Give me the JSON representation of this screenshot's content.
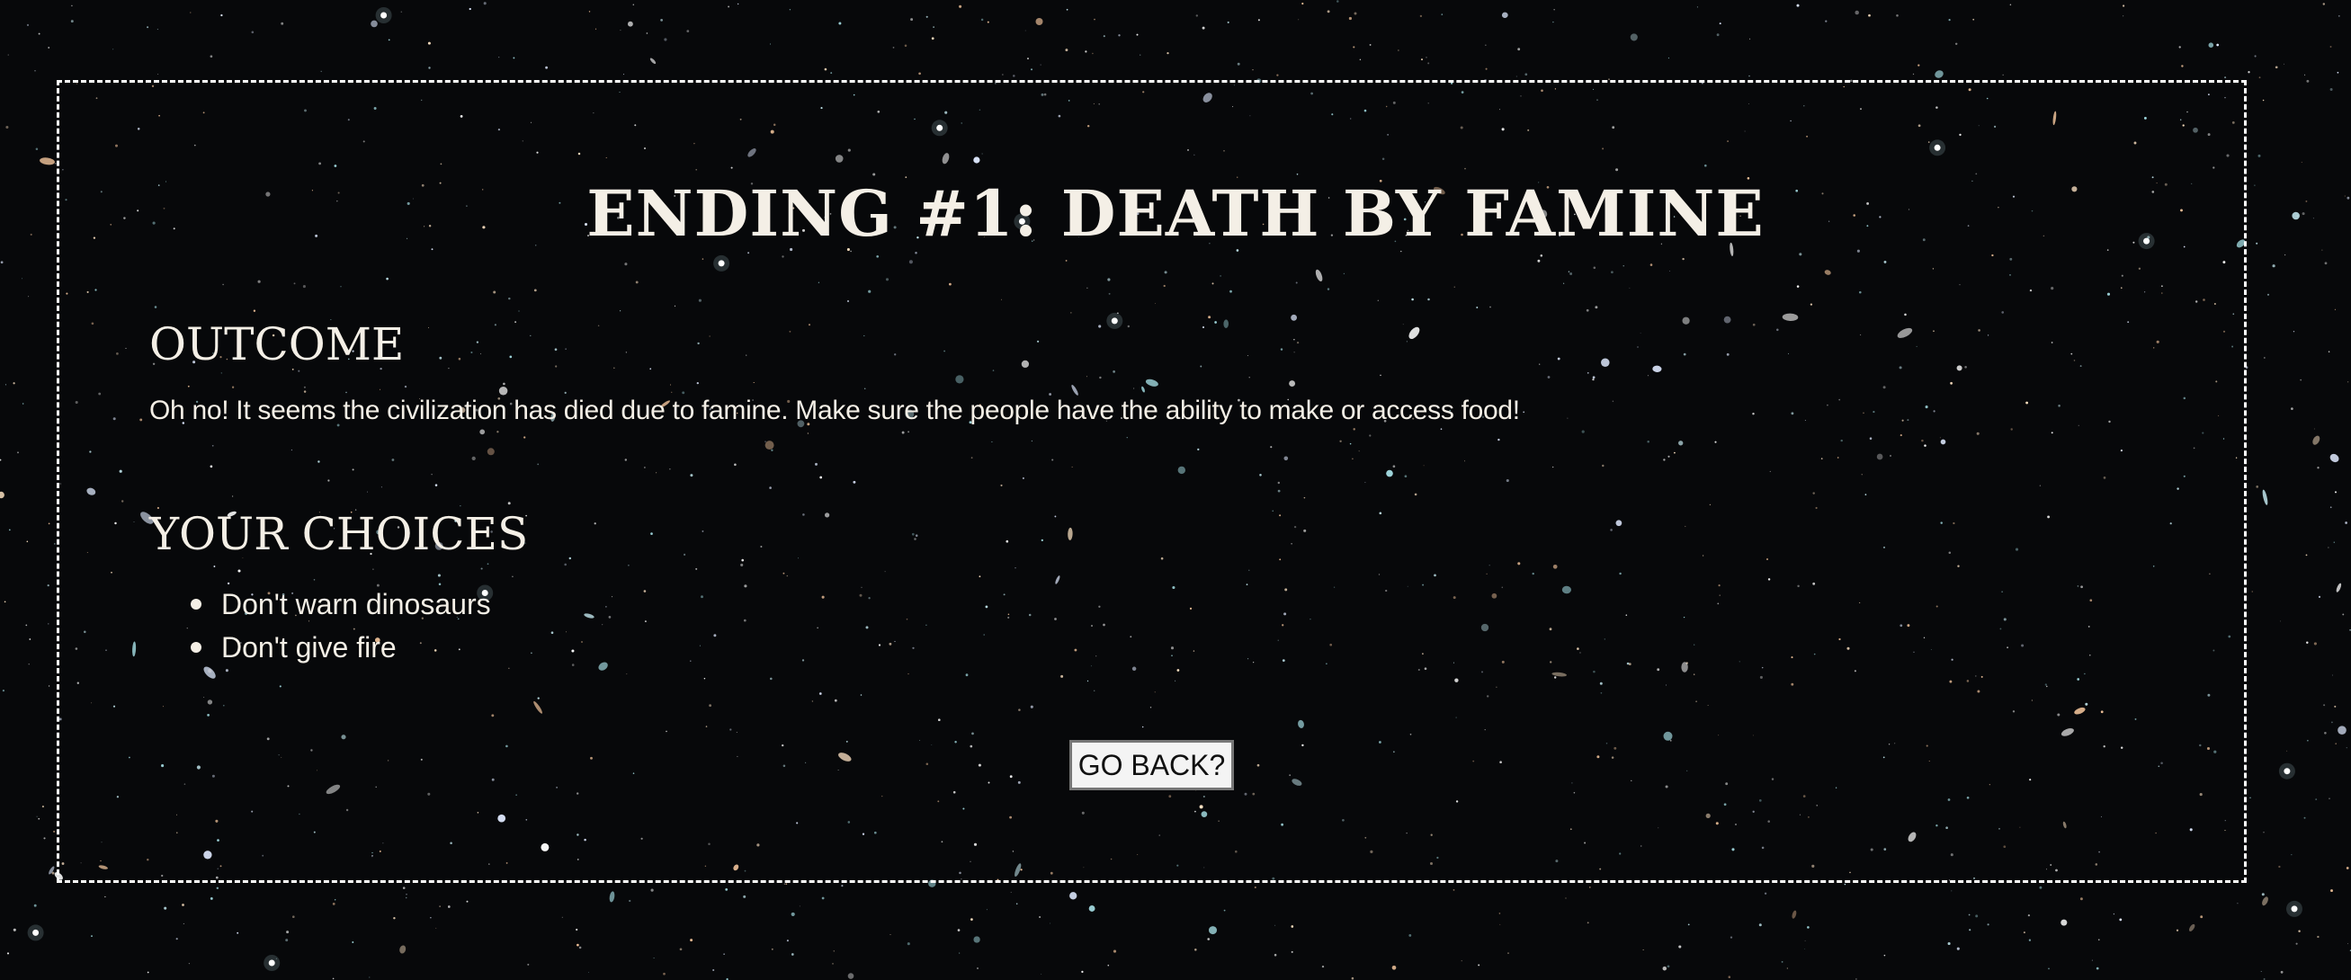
{
  "page": {
    "title": "ENDING #1: DEATH BY FAMINE"
  },
  "outcome": {
    "heading": "OUTCOME",
    "text": "Oh no! It seems the civilization has died due to famine. Make sure the people have the ability to make or access food!"
  },
  "choices": {
    "heading": "YOUR CHOICES",
    "items": [
      {
        "label": "Don't warn dinosaurs"
      },
      {
        "label": "Don't give fire"
      }
    ]
  },
  "actions": {
    "go_back_label": "GO BACK?"
  },
  "colors": {
    "background": "#07080a",
    "text": "#f4efe6",
    "frame_border": "#ffffff",
    "button_background": "#f4f4f4",
    "button_border": "#777777"
  }
}
